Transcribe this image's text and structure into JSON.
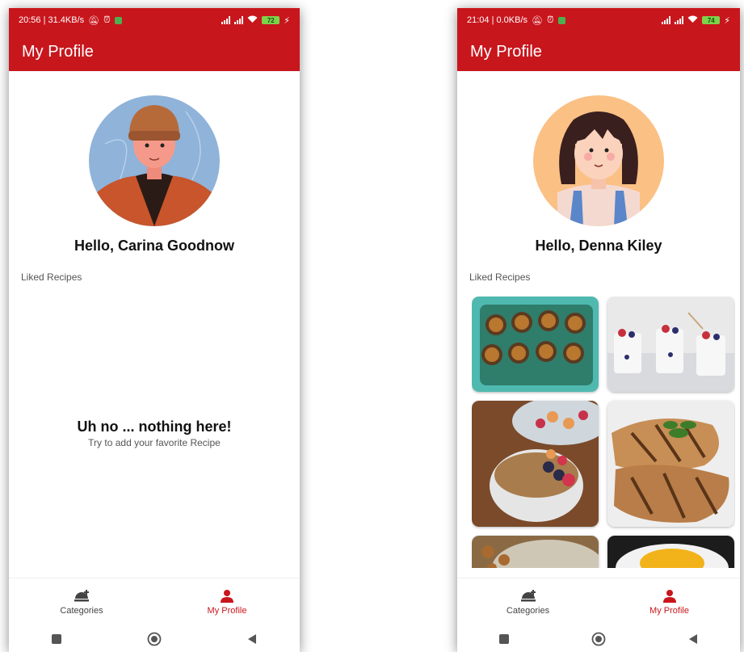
{
  "screens": [
    {
      "status": {
        "left": "20:56 | 31.4KB/s",
        "battery": "72"
      },
      "app_title": "My Profile",
      "greeting": "Hello, Carina Goodnow",
      "liked_label": "Liked Recipes",
      "empty_title": "Uh no ... nothing here!",
      "empty_subtitle": "Try to add your favorite Recipe",
      "nav": [
        {
          "label": "Categories",
          "icon": "food-tray-icon",
          "active": false
        },
        {
          "label": "My Profile",
          "icon": "person-icon",
          "active": true
        }
      ]
    },
    {
      "status": {
        "left": "21:04 | 0.0KB/s",
        "battery": "74"
      },
      "app_title": "My Profile",
      "greeting": "Hello, Denna Kiley",
      "liked_label": "Liked Recipes",
      "recipes": [
        {
          "image": "muffins-tray"
        },
        {
          "image": "yogurt-parfait-cups"
        },
        {
          "image": "granola-berry-bowl"
        },
        {
          "image": "grilled-chicken"
        },
        {
          "image": "nuts-bowl"
        },
        {
          "image": "egg-dish"
        }
      ],
      "nav": [
        {
          "label": "Categories",
          "icon": "food-tray-icon",
          "active": false
        },
        {
          "label": "My Profile",
          "icon": "person-icon",
          "active": true
        }
      ]
    }
  ],
  "colors": {
    "brand": "#c8161d",
    "active_nav": "#c8161d"
  },
  "system_nav_icons": [
    "recents-square-icon",
    "home-circle-icon",
    "back-triangle-icon"
  ]
}
